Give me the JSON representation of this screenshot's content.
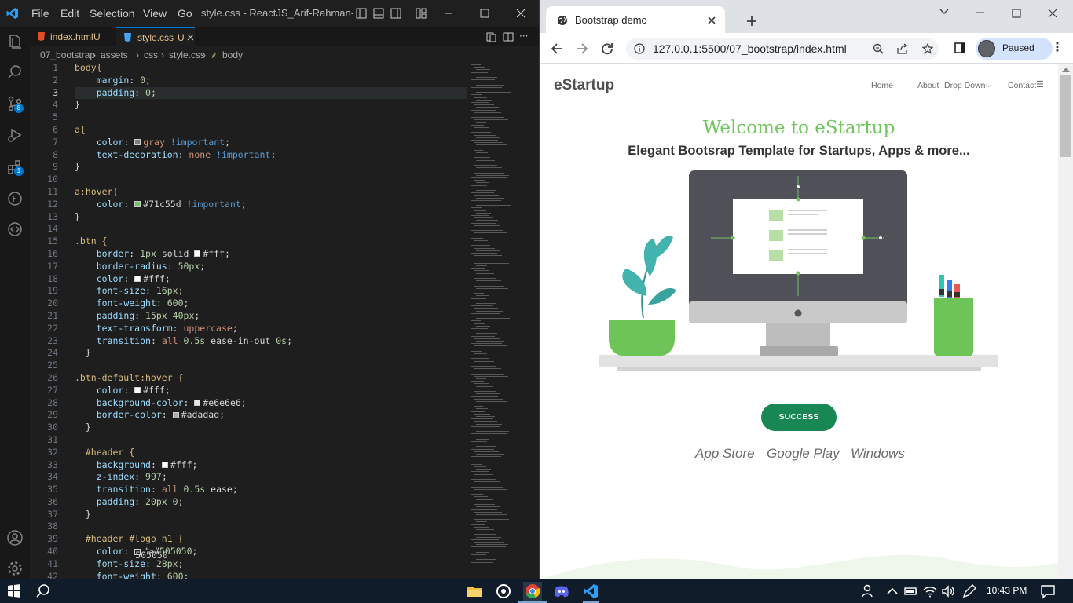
{
  "vscode": {
    "menu": [
      "File",
      "Edit",
      "Selection",
      "View",
      "Go"
    ],
    "window_title": "style.css - ReactJS_Arif-Rahman-Aji...",
    "tabs": [
      {
        "name": "index.html",
        "status": "U",
        "active": false
      },
      {
        "name": "style.css",
        "status": "U",
        "active": true
      }
    ],
    "breadcrumb": [
      "07_bootstrap",
      "assets",
      "css",
      "style.css",
      "body"
    ],
    "badges": {
      "source_control": "8",
      "extensions": "1"
    },
    "line_numbers": [
      "1",
      "2",
      "3",
      "4",
      "5",
      "6",
      "7",
      "8",
      "9",
      "10",
      "11",
      "12",
      "13",
      "14",
      "15",
      "16",
      "17",
      "18",
      "19",
      "20",
      "21",
      "22",
      "23",
      "24",
      "25",
      "26",
      "27",
      "28",
      "29",
      "30",
      "31",
      "32",
      "33",
      "34",
      "35",
      "36",
      "37",
      "38",
      "39",
      "40",
      "41",
      "42"
    ],
    "code": [
      "body{",
      "    margin: 0;",
      "    padding: 0;",
      "}",
      "",
      "a{",
      "    color: gray !important;",
      "    text-decoration: none !important;",
      "}",
      "",
      "a:hover{",
      "    color: #71c55d !important;",
      "}",
      "",
      ".btn {",
      "    border: 1px solid #fff;",
      "    border-radius: 50px;",
      "    color: #fff;",
      "    font-size: 16px;",
      "    font-weight: 600;",
      "    padding: 15px 40px;",
      "    text-transform: uppercase;",
      "    transition: all 0.5s ease-in-out 0s;",
      "  }",
      "",
      ".btn-default:hover {",
      "    color: #fff;",
      "    background-color: #e6e6e6;",
      "    border-color: #adadad;",
      "  }",
      "",
      "  #header {",
      "    background: #fff;",
      "    z-index: 997;",
      "    transition: all 0.5s ease;",
      "    padding: 20px 0;",
      "  }",
      "",
      "  #header #logo h1 {",
      "    color: #505050;",
      "    font-size: 28px;",
      "    font-weight: 600;"
    ]
  },
  "browser": {
    "tab_title": "Bootstrap demo",
    "url": "127.0.0.1:5500/07_bootstrap/index.html",
    "profile_label": "Paused",
    "page": {
      "logo": "eStartup",
      "nav": [
        "Home",
        "About",
        "Drop Down",
        "Contact"
      ],
      "title": "Welcome to eStartup",
      "subtitle": "Elegant Bootsrap Template for Startups, Apps & more...",
      "button": "SUCCESS",
      "stores": [
        "App Store",
        "Google Play",
        "Windows"
      ]
    }
  },
  "taskbar": {
    "time": "10:43 PM"
  },
  "colors": {
    "accent": "#71c55d",
    "success": "#198754",
    "editor_bg": "#1e1e1e",
    "taskbar": "#101c2a"
  }
}
